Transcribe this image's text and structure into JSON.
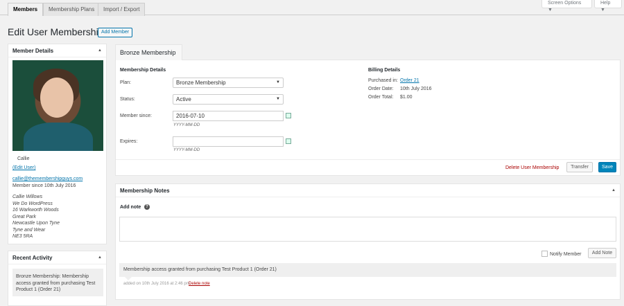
{
  "tabs": [
    "Members",
    "Membership Plans",
    "Import / Export"
  ],
  "top_buttons": {
    "screen_options": "Screen Options ▼",
    "help": "Help ▼"
  },
  "page": {
    "title": "Edit User Membership",
    "add_member": "Add Member"
  },
  "member_details": {
    "heading": "Member Details",
    "name": "Callie",
    "edit_user": "(Edit User)",
    "email": "callie@themembershipguys.com",
    "since": "Member since 10th July 2016",
    "address": [
      "Callie Willows",
      "We Do WordPress",
      "16 Warkworth Woods",
      "Great Park",
      "Newcastle Upon Tyne",
      "Tyne and Wear",
      "NE3 5RA"
    ]
  },
  "recent_activity": {
    "heading": "Recent Activity",
    "item_lines": [
      "Bronze Membership: Membership",
      "access granted from purchasing Test",
      "Product 1 (Order 21)"
    ]
  },
  "membership": {
    "tab_title": "Bronze Membership",
    "details_heading": "Membership Details",
    "plan_label": "Plan:",
    "plan_value": "Bronze Membership",
    "status_label": "Status:",
    "status_value": "Active",
    "since_label": "Member since:",
    "since_value": "2016-07-10",
    "date_hint": "YYYY-MM-DD",
    "expires_label": "Expires:",
    "expires_value": "",
    "expires_hint": "YYYY-MM-DD",
    "delete_link": "Delete User Membership",
    "transfer": "Transfer",
    "save": "Save"
  },
  "billing": {
    "heading": "Billing Details",
    "purchased_label": "Purchased in:",
    "purchased_value": "Order 21",
    "date_label": "Order Date:",
    "date_value": "10th July 2016",
    "total_label": "Order Total:",
    "total_value": "$1.00"
  },
  "notes": {
    "heading": "Membership Notes",
    "add_note_label": "Add note",
    "notify_label": "Notify Member",
    "add_note_button": "Add Note",
    "note_text": "Membership access granted from purchasing Test Product 1 (Order 21)",
    "note_meta": "added on 10th July 2016 at 2:46 pm",
    "delete_note": "Delete note"
  },
  "colors": {
    "primary": "#0085ba",
    "link": "#0073aa",
    "delete": "#a00"
  }
}
